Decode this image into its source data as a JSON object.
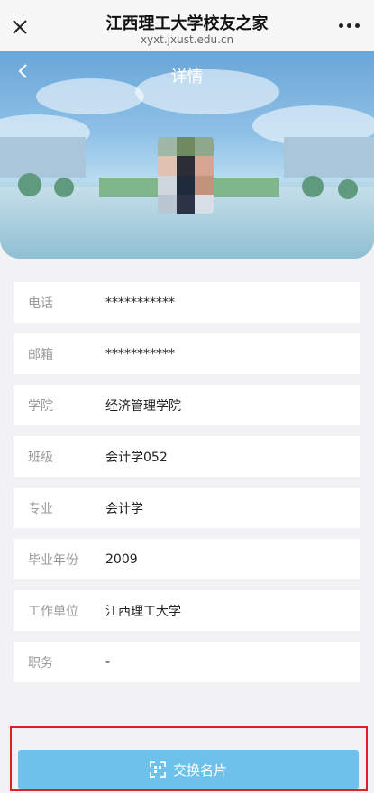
{
  "browser": {
    "title": "江西理工大学校友之家",
    "url": "xyxt.jxust.edu.cn"
  },
  "header": {
    "page_title": "详情"
  },
  "fields": [
    {
      "label": "电话",
      "value": "***********"
    },
    {
      "label": "邮箱",
      "value": "***********"
    },
    {
      "label": "学院",
      "value": "经济管理学院"
    },
    {
      "label": "班级",
      "value": "会计学052"
    },
    {
      "label": "专业",
      "value": "会计学"
    },
    {
      "label": "毕业年份",
      "value": "2009"
    },
    {
      "label": "工作单位",
      "value": "江西理工大学"
    },
    {
      "label": "职务",
      "value": "-"
    }
  ],
  "action": {
    "exchange_label": "交换名片"
  },
  "colors": {
    "accent": "#6ec1ea",
    "highlight_border": "#e02020",
    "page_bg": "#f2f2f4"
  },
  "icons": {
    "close": "close-icon",
    "more": "more-icon",
    "back": "back-icon",
    "exchange": "card-exchange-icon"
  }
}
